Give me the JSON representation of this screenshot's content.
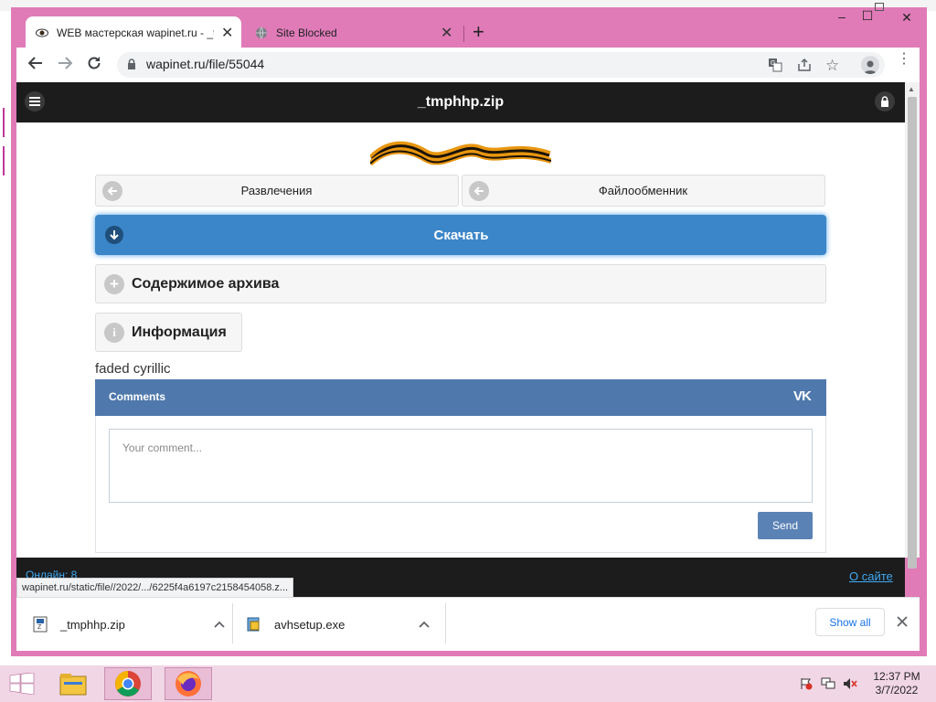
{
  "browser": {
    "tabs": [
      {
        "title": "WEB мастерская wapinet.ru - _tm",
        "active": true
      },
      {
        "title": "Site Blocked",
        "active": false
      }
    ],
    "new_tab": "+",
    "window_controls": {
      "minimize": "–",
      "maximize": "☐",
      "close": "✕"
    },
    "url": "wapinet.ru/file/55044",
    "status_url": "wapinet.ru/static/file//2022/.../6225f4a6197c2158454058.z..."
  },
  "site": {
    "title": "_tmphhp.zip",
    "nav": [
      {
        "label": "Развлечения"
      },
      {
        "label": "Файлообменник"
      }
    ],
    "download_label": "Скачать",
    "archive_label": "Содержимое архива",
    "info_label": "Информация",
    "description": "faded cyrillic",
    "comments": {
      "title": "Comments",
      "logo": "VK",
      "placeholder": "Your comment...",
      "send": "Send"
    },
    "footer": {
      "online": "Онлайн: 8",
      "about": "О сайте"
    }
  },
  "downloads": {
    "items": [
      {
        "name": "_tmphhp.zip"
      },
      {
        "name": "avhsetup.exe"
      }
    ],
    "show_all": "Show all"
  },
  "taskbar": {
    "time": "12:37 PM",
    "date": "3/7/2022"
  },
  "colors": {
    "frame": "#e07bb8",
    "download_button": "#3b86c9",
    "vk_header": "#4f79ac",
    "site_header": "#1c1c1c"
  }
}
